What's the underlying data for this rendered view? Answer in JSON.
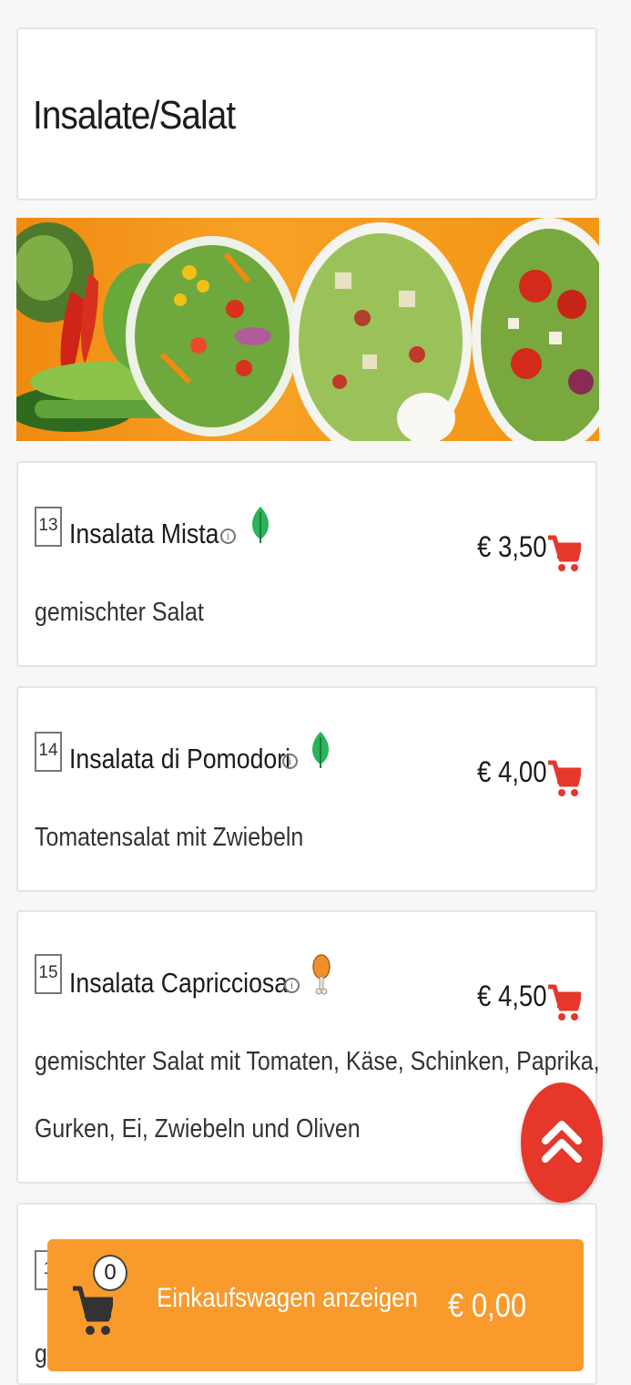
{
  "section": {
    "title": "Insalate/Salat"
  },
  "items": [
    {
      "number": "13",
      "name": "Insalata Mista",
      "price": "€ 3,50",
      "desc": [
        "gemischter Salat"
      ],
      "diet_icon": "leaf-icon"
    },
    {
      "number": "14",
      "name": "Insalata di Pomodori",
      "price": "€ 4,00",
      "desc": [
        "Tomatensalat mit Zwiebeln"
      ],
      "diet_icon": "leaf-icon"
    },
    {
      "number": "15",
      "name": "Insalata Capricciosa",
      "price": "€ 4,50",
      "desc": [
        "gemischter Salat mit Tomaten, Käse, Schinken, Paprika,",
        "Gurken, Ei, Zwiebeln und Oliven"
      ],
      "diet_icon": "chicken-leg-icon"
    },
    {
      "number": "1",
      "desc_partial": "g"
    }
  ],
  "cart": {
    "count": "0",
    "label": "Einkaufswagen anzeigen",
    "total": "€ 0,00"
  },
  "colors": {
    "accent": "#e5382b",
    "cart_bar": "#f89a2c",
    "leaf": "#2bb35a"
  }
}
